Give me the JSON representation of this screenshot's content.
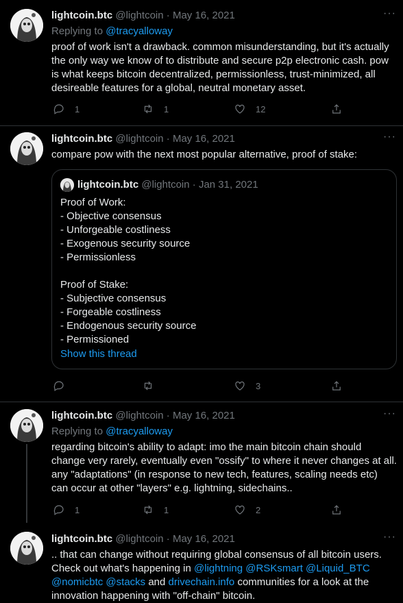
{
  "tweets": [
    {
      "name": "lightcoin.btc",
      "handle": "@lightcoin",
      "dot": "·",
      "date": "May 16, 2021",
      "more": "···",
      "replying_prefix": "Replying to ",
      "replying_handle": "@tracyalloway",
      "lines": [
        "proof of work isn't a drawback. common misunderstanding, but it's actually",
        "the only way we know of to distribute and secure p2p electronic cash. pow",
        "is what keeps bitcoin decentralized, permissionless, trust-minimized, all",
        "desireable features for a global, neutral monetary asset."
      ],
      "reply_count": "1",
      "retweet_count": "1",
      "like_count": "12"
    },
    {
      "name": "lightcoin.btc",
      "handle": "@lightcoin",
      "dot": "·",
      "date": "May 16, 2021",
      "more": "···",
      "lines": [
        "compare pow with the next most popular alternative, proof of stake:"
      ],
      "quote": {
        "name": "lightcoin.btc",
        "handle": "@lightcoin",
        "dot": "·",
        "date": "Jan 31, 2021",
        "lines": [
          "Proof of Work:",
          "- Objective consensus",
          "- Unforgeable costliness",
          "- Exogenous security source",
          "- Permissionless",
          "",
          "Proof of Stake:",
          "- Subjective consensus",
          "- Forgeable costliness",
          "- Endogenous security source",
          "- Permissioned"
        ],
        "show_thread": "Show this thread"
      },
      "reply_count": "",
      "retweet_count": "",
      "like_count": "3"
    },
    {
      "name": "lightcoin.btc",
      "handle": "@lightcoin",
      "dot": "·",
      "date": "May 16, 2021",
      "more": "···",
      "replying_prefix": "Replying to ",
      "replying_handle": "@tracyalloway",
      "lines": [
        "regarding bitcoin's ability to adapt: imo the main bitcoin chain should",
        "change very rarely, eventually even \"ossify\" to where it never changes at all.",
        "any \"adaptations\" (in response to new tech, features, scaling needs etc)",
        "can occur at other \"layers\" e.g. lightning, sidechains.."
      ],
      "reply_count": "1",
      "retweet_count": "1",
      "like_count": "2"
    },
    {
      "name": "lightcoin.btc",
      "handle": "@lightcoin",
      "dot": "·",
      "date": "May 16, 2021",
      "more": "···",
      "line1": ".. that can change without requiring global consensus of all bitcoin users.",
      "line2_text": "Check out what's happening in ",
      "mentions_a": [
        "@lightning",
        "@RSKsmart",
        "@Liquid_BTC"
      ],
      "mentions_b": [
        "@nomicbtc",
        "@stacks"
      ],
      "and": " and ",
      "drivechain": "drivechain.info",
      "line3_tail": " communities for a look at the",
      "line4": "innovation happening with \"off-chain\" bitcoin."
    }
  ],
  "colors": {
    "background": "#000000",
    "text": "#e7e9ea",
    "secondary": "#71767b",
    "link": "#1d9bf0",
    "border": "#2f3336"
  },
  "icons": [
    "reply-icon",
    "retweet-icon",
    "like-icon",
    "share-icon",
    "more-icon"
  ]
}
